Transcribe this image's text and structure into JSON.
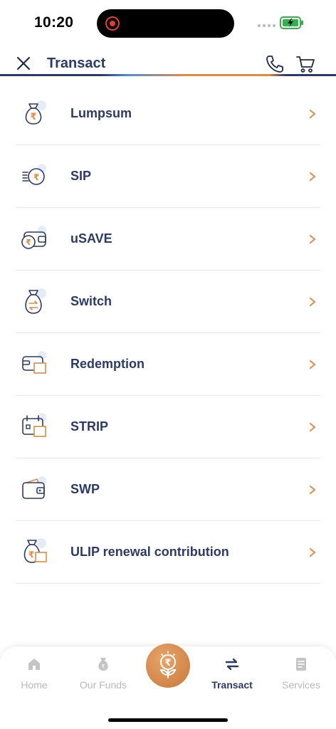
{
  "status_bar": {
    "time": "10:20"
  },
  "header": {
    "title": "Transact"
  },
  "menu": {
    "items": [
      {
        "label": "Lumpsum",
        "icon": "money-bag-rupee-icon"
      },
      {
        "label": "SIP",
        "icon": "rupee-coin-stack-icon"
      },
      {
        "label": "uSAVE",
        "icon": "wallet-rupee-icon"
      },
      {
        "label": "Switch",
        "icon": "money-bag-switch-icon"
      },
      {
        "label": "Redemption",
        "icon": "wallet-redeem-icon"
      },
      {
        "label": "STRIP",
        "icon": "calendar-wallet-icon"
      },
      {
        "label": "SWP",
        "icon": "wallet-cash-icon"
      },
      {
        "label": "ULIP renewal contribution",
        "icon": "money-bag-renewal-icon"
      }
    ]
  },
  "bottom_nav": {
    "items": [
      {
        "label": "Home",
        "icon": "home-icon",
        "active": false
      },
      {
        "label": "Our Funds",
        "icon": "fund-bag-icon",
        "active": false
      },
      {
        "label": "Transact",
        "icon": "transfer-arrows-icon",
        "active": true
      },
      {
        "label": "Services",
        "icon": "document-icon",
        "active": false
      }
    ],
    "center_icon": "rupee-plant-icon"
  },
  "colors": {
    "primary": "#2b3a6b",
    "accent": "#e58a3c",
    "inactive": "#b9b9b9",
    "divider": "#e7e7e7"
  }
}
